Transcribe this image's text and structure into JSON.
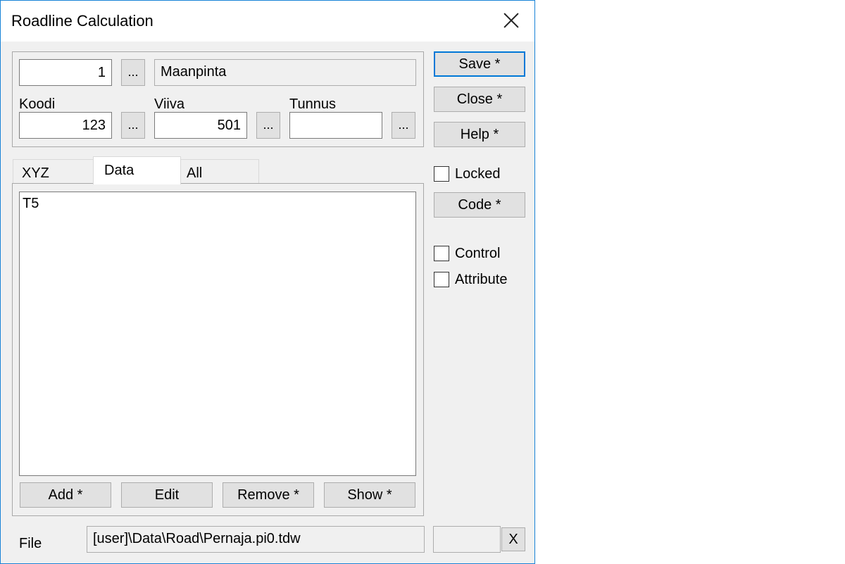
{
  "window": {
    "title": "Roadline Calculation"
  },
  "top_row": {
    "number_value": "1",
    "name_value": "Maanpinta"
  },
  "fields": {
    "koodi": {
      "label": "Koodi",
      "value": "123"
    },
    "viiva": {
      "label": "Viiva",
      "value": "501"
    },
    "tunnus": {
      "label": "Tunnus",
      "value": ""
    }
  },
  "browse_label": "...",
  "side_buttons": {
    "save": "Save *",
    "close": "Close *",
    "help": "Help *",
    "code": "Code *"
  },
  "checkboxes": {
    "locked": "Locked",
    "control": "Control",
    "attribute": "Attribute"
  },
  "tabs": [
    {
      "label": "XYZ"
    },
    {
      "label": "Data"
    },
    {
      "label": "All"
    }
  ],
  "list": {
    "items": [
      "T5"
    ]
  },
  "list_buttons": {
    "add": "Add *",
    "edit": "Edit",
    "remove": "Remove *",
    "show": "Show *"
  },
  "file": {
    "label": "File",
    "path": "[user]\\Data\\Road\\Pernaja.pi0.tdw",
    "extra_value": "",
    "clear_label": "X"
  },
  "colors": {
    "accent": "#0078d7",
    "dialog_bg": "#f0f0f0",
    "window_border": "#1883d7"
  }
}
